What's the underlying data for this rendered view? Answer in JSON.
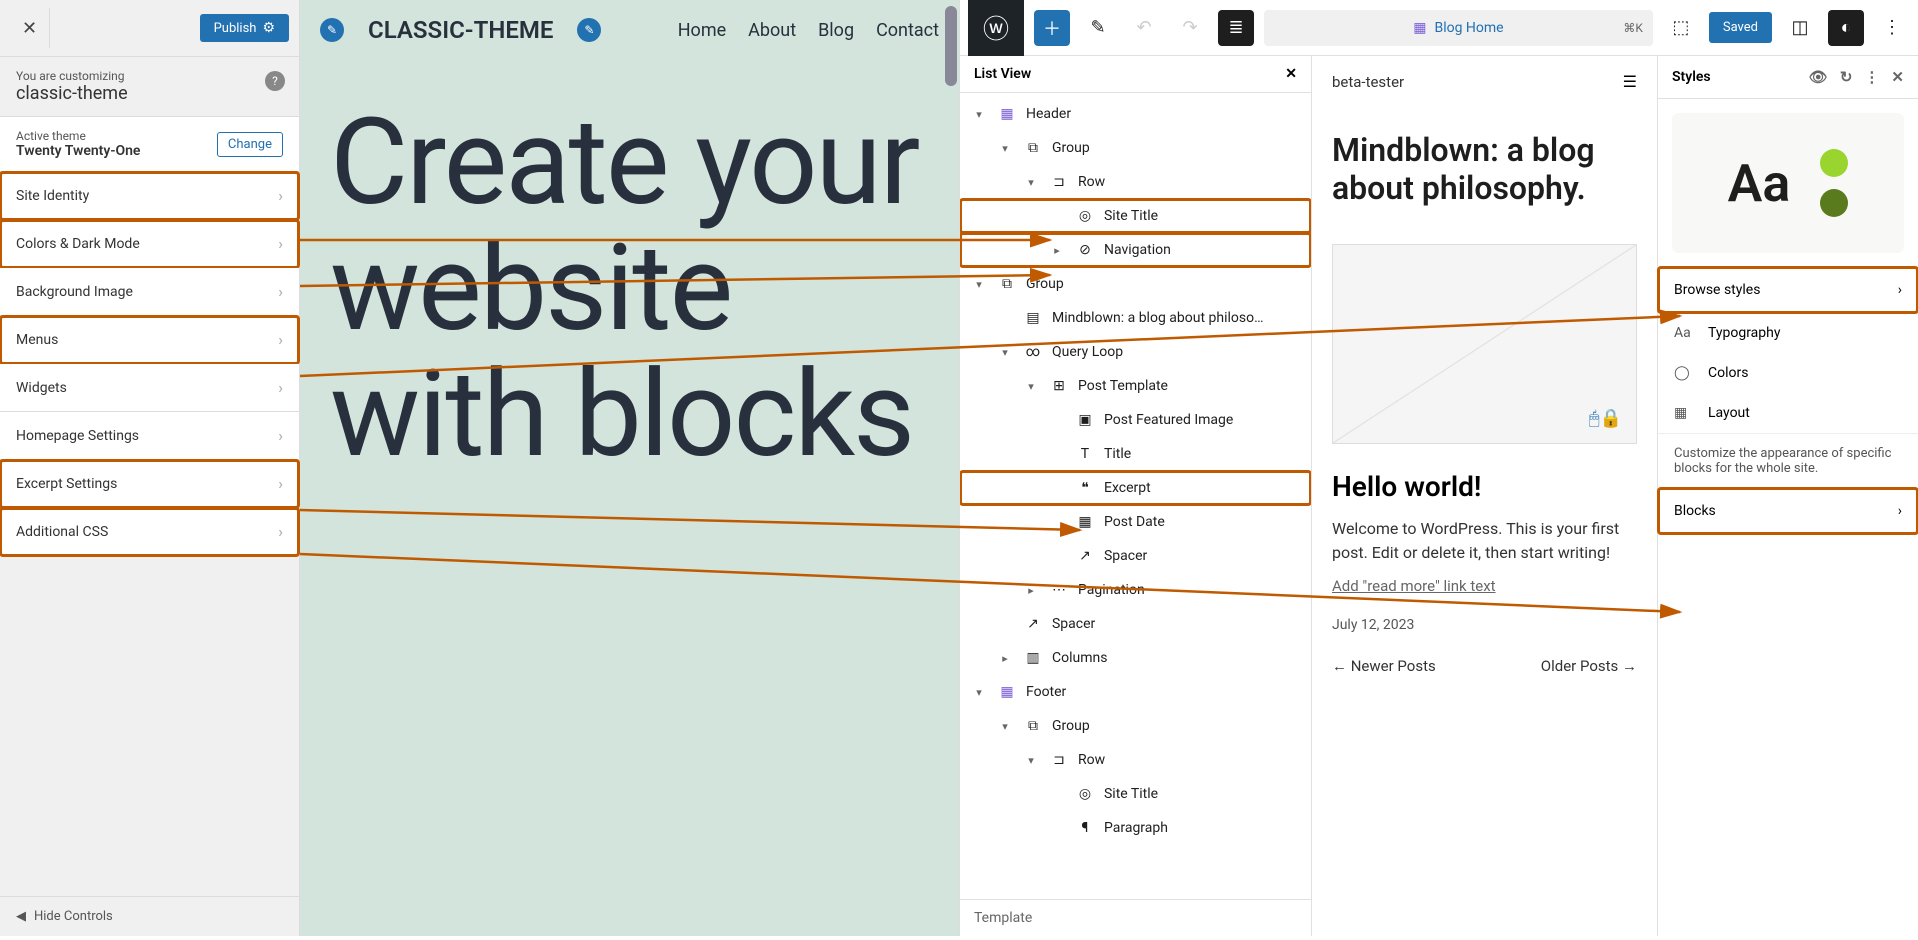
{
  "customizer": {
    "publish": "Publish",
    "you_are_customizing": "You are customizing",
    "theme_name": "classic-theme",
    "active_theme_label": "Active theme",
    "active_theme_name": "Twenty Twenty-One",
    "change": "Change",
    "items": [
      {
        "label": "Site Identity",
        "hl": true
      },
      {
        "label": "Colors & Dark Mode",
        "hl": true
      },
      {
        "label": "Background Image",
        "hl": false
      },
      {
        "label": "Menus",
        "hl": true
      },
      {
        "label": "Widgets",
        "hl": false
      },
      {
        "label": "Homepage Settings",
        "hl": false
      },
      {
        "label": "Excerpt Settings",
        "hl": true
      },
      {
        "label": "Additional CSS",
        "hl": true
      }
    ],
    "hide_controls": "Hide Controls"
  },
  "preview": {
    "site_title": "CLASSIC-THEME",
    "nav": [
      "Home",
      "About",
      "Blog",
      "Contact"
    ],
    "hero": "Create your website with blocks"
  },
  "editor": {
    "search_label": "Blog Home",
    "search_kb": "⌘K",
    "saved": "Saved",
    "list_view_title": "List View",
    "tree": [
      {
        "lvl": 0,
        "caret": "▾",
        "icon": "▦",
        "label": "Header",
        "color": "purple"
      },
      {
        "lvl": 1,
        "caret": "▾",
        "icon": "⧉",
        "label": "Group"
      },
      {
        "lvl": 2,
        "caret": "▾",
        "icon": "⊐",
        "label": "Row"
      },
      {
        "lvl": 3,
        "caret": "",
        "icon": "◎",
        "label": "Site Title",
        "hl": true
      },
      {
        "lvl": 3,
        "caret": "▸",
        "icon": "⊘",
        "label": "Navigation",
        "hl": true
      },
      {
        "lvl": 0,
        "caret": "▾",
        "icon": "⧉",
        "label": "Group"
      },
      {
        "lvl": 1,
        "caret": "",
        "icon": "▤",
        "label": "Mindblown: a blog about philoso…"
      },
      {
        "lvl": 1,
        "caret": "▾",
        "icon": "∞",
        "label": "Query Loop"
      },
      {
        "lvl": 2,
        "caret": "▾",
        "icon": "⊞",
        "label": "Post Template"
      },
      {
        "lvl": 3,
        "caret": "",
        "icon": "▣",
        "label": "Post Featured Image"
      },
      {
        "lvl": 3,
        "caret": "",
        "icon": "T",
        "label": "Title"
      },
      {
        "lvl": 3,
        "caret": "",
        "icon": "❝",
        "label": "Excerpt",
        "hl": true
      },
      {
        "lvl": 3,
        "caret": "",
        "icon": "▦",
        "label": "Post Date"
      },
      {
        "lvl": 3,
        "caret": "",
        "icon": "↗",
        "label": "Spacer"
      },
      {
        "lvl": 2,
        "caret": "▸",
        "icon": "⋯",
        "label": "Pagination"
      },
      {
        "lvl": 1,
        "caret": "",
        "icon": "↗",
        "label": "Spacer"
      },
      {
        "lvl": 1,
        "caret": "▸",
        "icon": "▥",
        "label": "Columns"
      },
      {
        "lvl": 0,
        "caret": "▾",
        "icon": "▦",
        "label": "Footer",
        "color": "purple"
      },
      {
        "lvl": 1,
        "caret": "▾",
        "icon": "⧉",
        "label": "Group"
      },
      {
        "lvl": 2,
        "caret": "▾",
        "icon": "⊐",
        "label": "Row"
      },
      {
        "lvl": 3,
        "caret": "",
        "icon": "◎",
        "label": "Site Title"
      },
      {
        "lvl": 3,
        "caret": "",
        "icon": "¶",
        "label": "Paragraph"
      }
    ],
    "template_label": "Template"
  },
  "canvas": {
    "site_title": "beta-tester",
    "heading": "Mindblown: a blog about philosophy.",
    "post_title": "Hello world!",
    "excerpt": "Welcome to WordPress. This is your first post. Edit or delete it, then start writing!",
    "read_more": "Add \"read more\" link text",
    "date": "July 12, 2023",
    "newer": "Newer Posts",
    "older": "Older Posts"
  },
  "styles": {
    "title": "Styles",
    "browse": "Browse styles",
    "typography": "Typography",
    "colors": "Colors",
    "layout": "Layout",
    "desc": "Customize the appearance of specific blocks for the whole site.",
    "blocks": "Blocks"
  }
}
